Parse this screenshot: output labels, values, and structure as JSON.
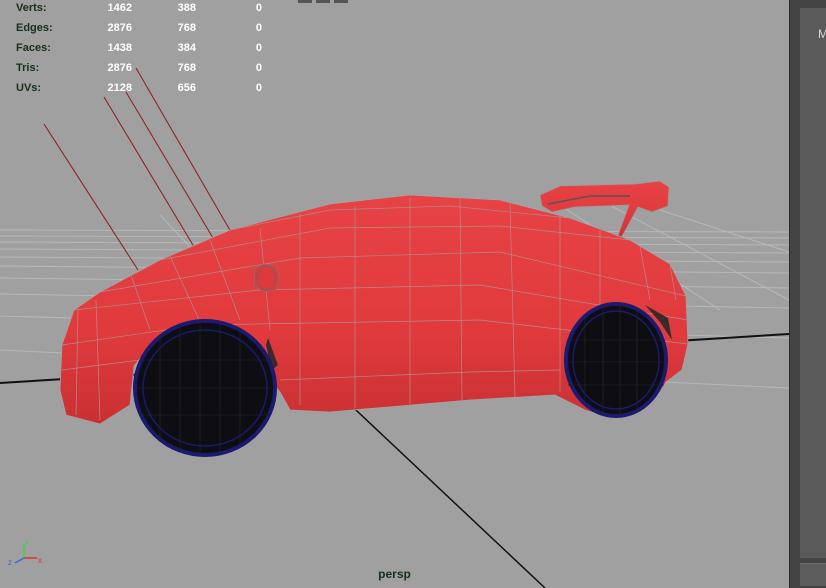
{
  "hud": {
    "rows": [
      {
        "label": "Verts:",
        "values": [
          "1462",
          "388",
          "0"
        ]
      },
      {
        "label": "Edges:",
        "values": [
          "2876",
          "768",
          "0"
        ]
      },
      {
        "label": "Faces:",
        "values": [
          "1438",
          "384",
          "0"
        ]
      },
      {
        "label": "Tris:",
        "values": [
          "2876",
          "768",
          "0"
        ]
      },
      {
        "label": "UVs:",
        "values": [
          "2128",
          "656",
          "0"
        ]
      }
    ]
  },
  "viewport": {
    "camera_label": "persp",
    "background_color": "#a0a0a0",
    "model_color": "#e8383a",
    "wheel_color": "#0d0d12",
    "wireframe_color": "#1a1a70"
  },
  "axis_indicator": {
    "x": "x",
    "y": "y",
    "z": "z"
  },
  "right_panel": {
    "letter": "M"
  },
  "icons": [
    "view-axis-icon"
  ]
}
